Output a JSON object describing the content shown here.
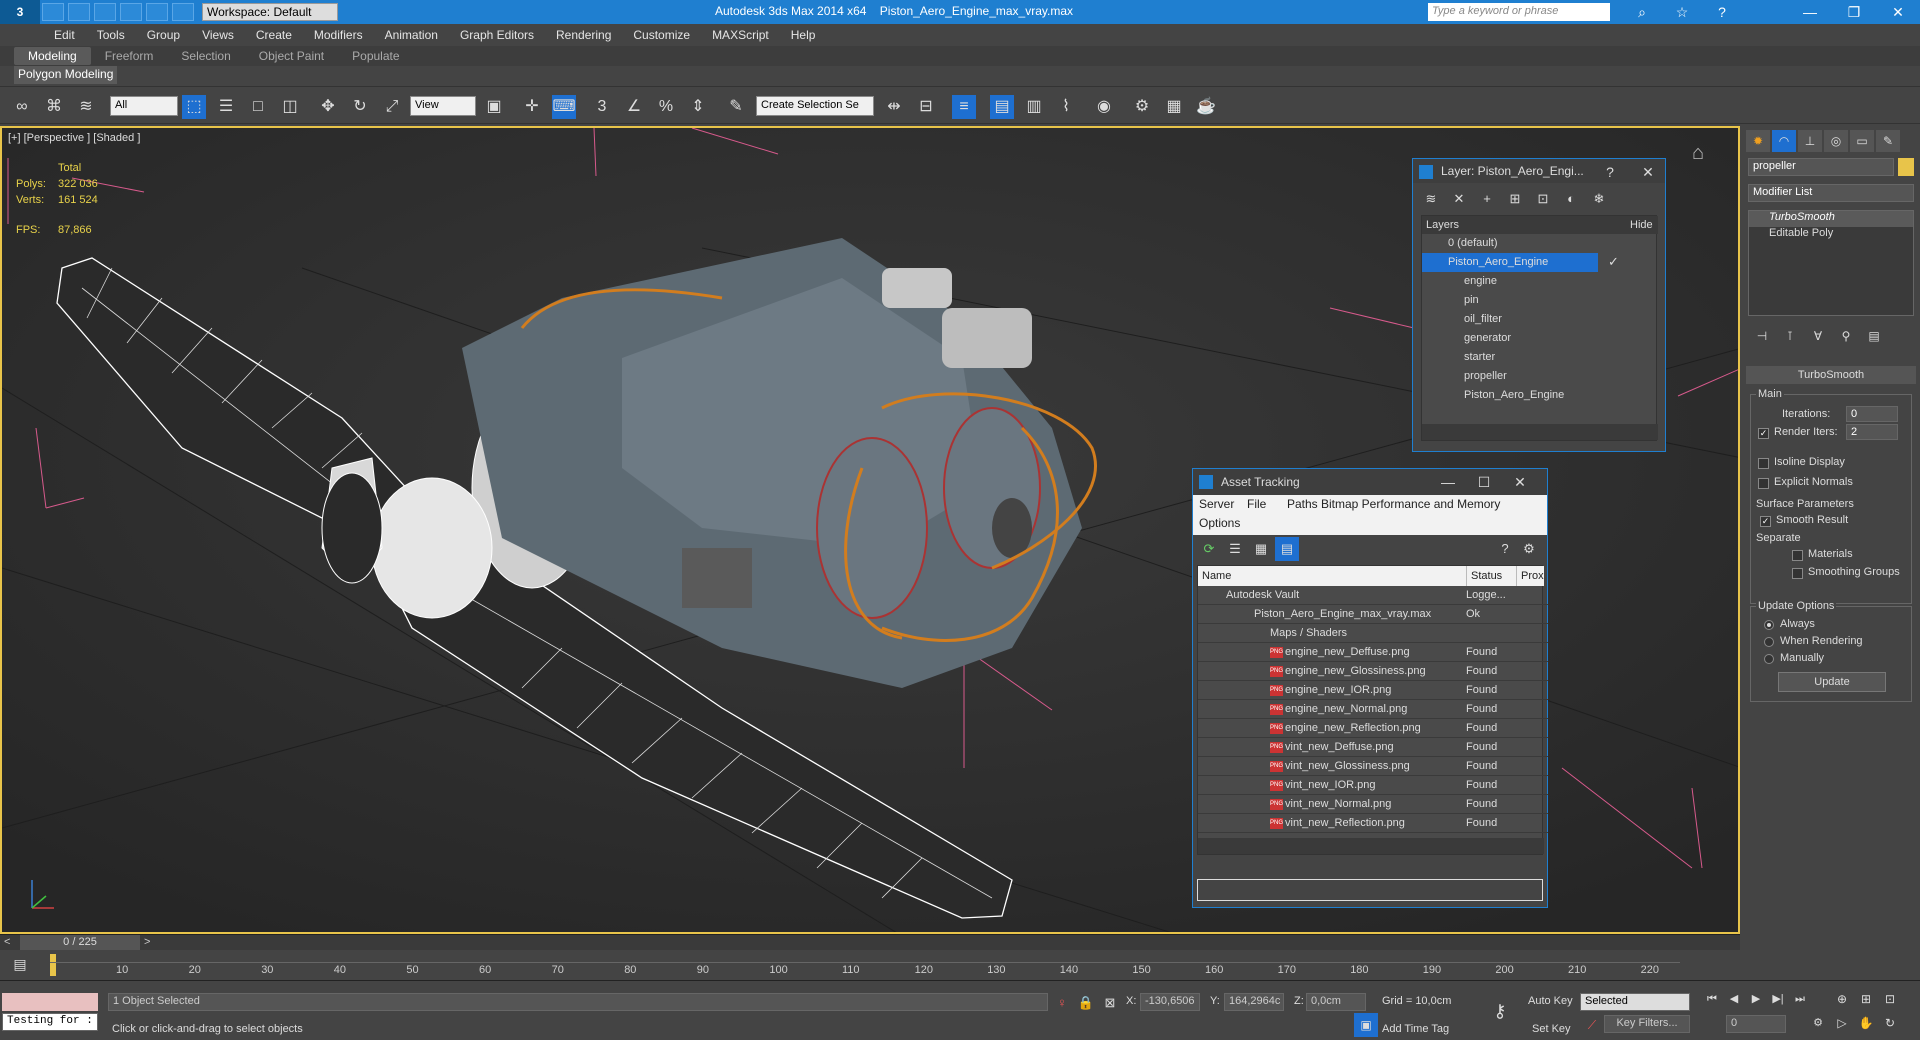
{
  "titlebar": {
    "workspace": "Workspace: Default",
    "app": "Autodesk 3ds Max  2014 x64",
    "file": "Piston_Aero_Engine_max_vray.max",
    "search_placeholder": "Type a keyword or phrase"
  },
  "menu": [
    "Edit",
    "Tools",
    "Group",
    "Views",
    "Create",
    "Modifiers",
    "Animation",
    "Graph Editors",
    "Rendering",
    "Customize",
    "MAXScript",
    "Help"
  ],
  "ribbon_tabs": [
    "Modeling",
    "Freeform",
    "Selection",
    "Object Paint",
    "Populate"
  ],
  "ribbon_sub": "Polygon Modeling",
  "toolbar": {
    "filter": "All",
    "ref_coord": "View",
    "named_sel": "Create Selection Se"
  },
  "viewport": {
    "label": "[+] [Perspective ] [Shaded ]",
    "stats": {
      "total_label": "Total",
      "polys_label": "Polys:",
      "polys": "322 036",
      "verts_label": "Verts:",
      "verts": "161 524",
      "fps_label": "FPS:",
      "fps": "87,866"
    }
  },
  "layer_window": {
    "title": "Layer: Piston_Aero_Engi...",
    "col_layers": "Layers",
    "col_hide": "Hide",
    "rows": [
      "0 (default)",
      "Piston_Aero_Engine",
      "engine",
      "pin",
      "oil_filter",
      "generator",
      "starter",
      "propeller",
      "Piston_Aero_Engine"
    ]
  },
  "asset_tracking": {
    "title": "Asset Tracking",
    "menu": [
      "Server",
      "File",
      "Paths",
      "Bitmap Performance and Memory",
      "Options"
    ],
    "col_name": "Name",
    "col_status": "Status",
    "col_prox": "Prox",
    "rows": [
      {
        "name": "Autodesk Vault",
        "status": "Logge..."
      },
      {
        "name": "Piston_Aero_Engine_max_vray.max",
        "status": "Ok"
      },
      {
        "name": "Maps / Shaders",
        "status": ""
      },
      {
        "name": "engine_new_Deffuse.png",
        "status": "Found"
      },
      {
        "name": "engine_new_Glossiness.png",
        "status": "Found"
      },
      {
        "name": "engine_new_IOR.png",
        "status": "Found"
      },
      {
        "name": "engine_new_Normal.png",
        "status": "Found"
      },
      {
        "name": "engine_new_Reflection.png",
        "status": "Found"
      },
      {
        "name": "vint_new_Deffuse.png",
        "status": "Found"
      },
      {
        "name": "vint_new_Glossiness.png",
        "status": "Found"
      },
      {
        "name": "vint_new_IOR.png",
        "status": "Found"
      },
      {
        "name": "vint_new_Normal.png",
        "status": "Found"
      },
      {
        "name": "vint_new_Reflection.png",
        "status": "Found"
      }
    ]
  },
  "command_panel": {
    "object_name": "propeller",
    "modifier_list": "Modifier List",
    "stack": [
      "TurboSmooth",
      "Editable Poly"
    ],
    "rollout": "TurboSmooth",
    "main": "Main",
    "iterations_label": "Iterations:",
    "iterations": "0",
    "render_iters_label": "Render Iters:",
    "render_iters": "2",
    "isoline": "Isoline Display",
    "explicit": "Explicit Normals",
    "surface": "Surface Parameters",
    "smooth_result": "Smooth Result",
    "separate": "Separate",
    "materials": "Materials",
    "smoothing_groups": "Smoothing Groups",
    "update_options": "Update Options",
    "always": "Always",
    "when_rendering": "When Rendering",
    "manually": "Manually",
    "update_btn": "Update"
  },
  "timeline": {
    "frame": "0 / 225",
    "ticks": [
      "10",
      "20",
      "30",
      "40",
      "50",
      "60",
      "70",
      "80",
      "90",
      "100",
      "110",
      "120",
      "130",
      "140",
      "150",
      "160",
      "170",
      "180",
      "190",
      "200",
      "210",
      "220"
    ]
  },
  "statusbar": {
    "script": "Testing for :",
    "selected": "1 Object Selected",
    "prompt": "Click or click-and-drag to select objects",
    "x_label": "X:",
    "x": "-130,6506",
    "y_label": "Y:",
    "y": "164,2964c",
    "z_label": "Z:",
    "z": "0,0cm",
    "grid": "Grid = 10,0cm",
    "add_time_tag": "Add Time Tag",
    "auto_key": "Auto Key",
    "selected_mode": "Selected",
    "set_key": "Set Key",
    "key_filters": "Key Filters...",
    "frame_field": "0"
  }
}
